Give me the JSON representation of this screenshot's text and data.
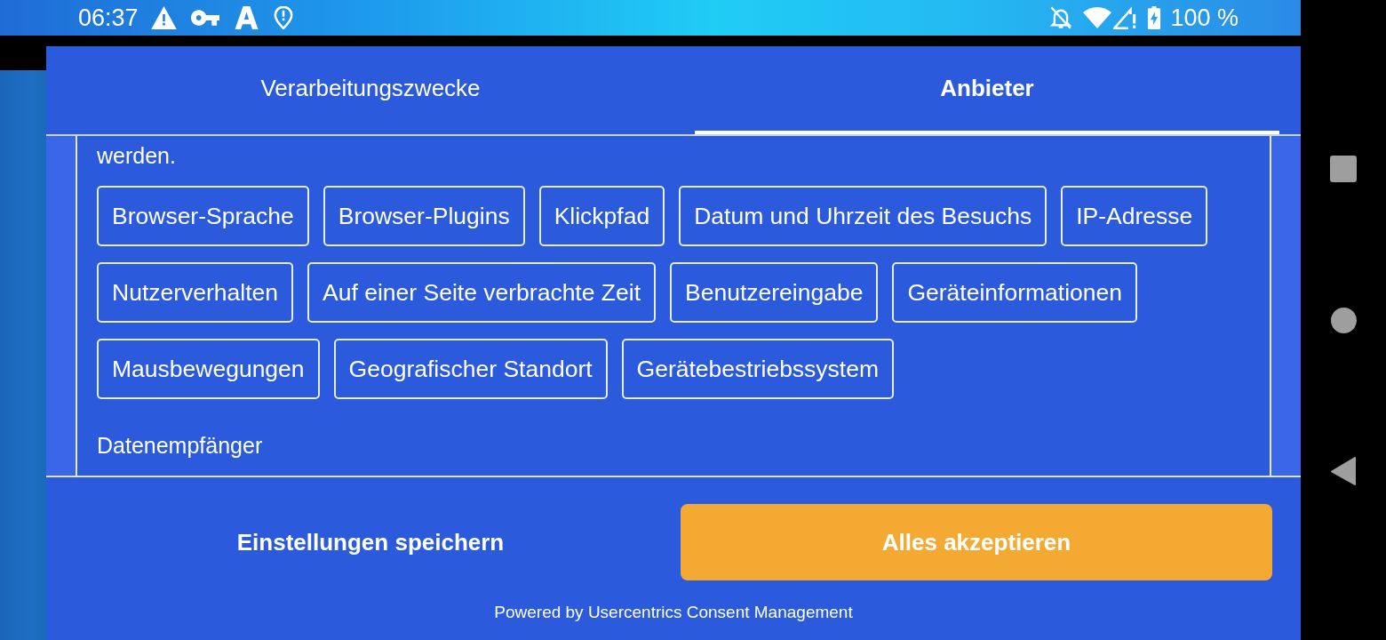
{
  "status_bar": {
    "time": "06:37",
    "battery": "100 %"
  },
  "tabs": [
    {
      "label": "Verarbeitungszwecke",
      "selected": false
    },
    {
      "label": "Anbieter",
      "selected": true
    }
  ],
  "vendor_details": {
    "description": "werden.",
    "data_categories": [
      "Browser-Sprache",
      "Browser-Plugins",
      "Klickpfad",
      "Datum und Uhrzeit des Besuchs",
      "IP-Adresse",
      "Nutzerverhalten",
      "Auf einer Seite verbrachte Zeit",
      "Benutzereingabe",
      "Geräteinformationen",
      "Mausbewegungen",
      "Geografischer Standort",
      "Gerätebestriebssystem"
    ],
    "section_heading": "Datenempfänger"
  },
  "buttons": [
    {
      "label": "Einstellungen speichern",
      "kind": "text"
    },
    {
      "label": "Alles akzeptieren",
      "kind": "primary"
    }
  ],
  "footer": "Powered by Usercentrics Consent Management"
}
